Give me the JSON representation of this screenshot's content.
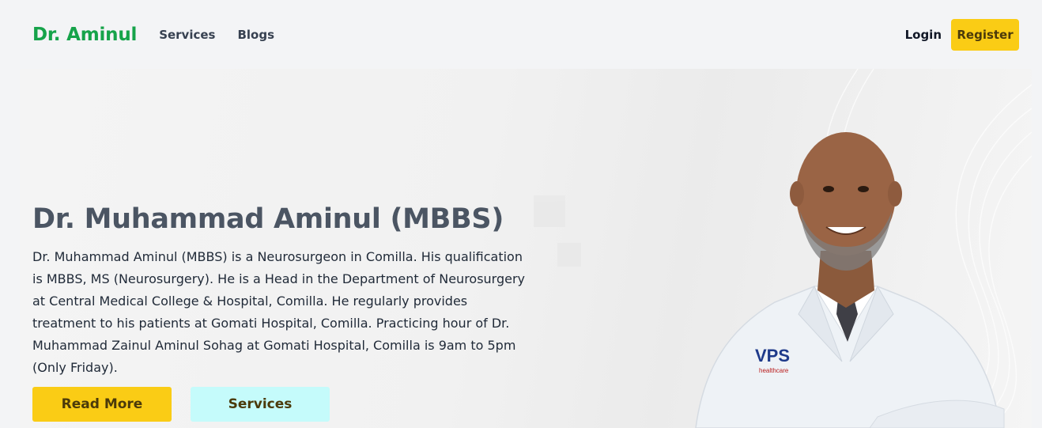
{
  "nav": {
    "brand": "Dr. Aminul",
    "links": [
      "Services",
      "Blogs"
    ],
    "login": "Login",
    "register": "Register"
  },
  "hero": {
    "title": "Dr. Muhammad Aminul (MBBS)",
    "description": "Dr. Muhammad Aminul (MBBS) is a Neurosurgeon in Comilla. His qualification is MBBS, MS (Neurosurgery). He is a Head in the Department of Neurosurgery at Central Medical College & Hospital, Comilla. He regularly provides treatment to his patients at Gomati Hospital, Comilla. Practicing hour of Dr. Muhammad Zainul Aminul Sohag at Gomati Hospital, Comilla is 9am to 5pm (Only Friday).",
    "read_more": "Read More",
    "services": "Services",
    "coat_logo": "VPS healthcare"
  },
  "colors": {
    "brand": "#16a34a",
    "accent_yellow": "#facc15",
    "accent_cyan": "#c5fbfb"
  }
}
